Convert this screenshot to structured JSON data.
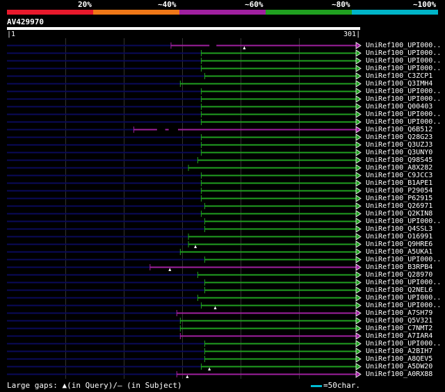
{
  "legend": {
    "labels": [
      "20%",
      "~40%",
      "~60%",
      "~80%",
      "~100%"
    ],
    "colors": [
      "#e8192c",
      "#f07818",
      "#a020a0",
      "#20a020",
      "#00b4c8"
    ]
  },
  "query": {
    "id": "AV429970",
    "start": "1",
    "end": "301",
    "length": 301
  },
  "footer": {
    "gaps_text": "Large gaps: ▲(in Query)/– (in Subject)",
    "scale_text": "=50char."
  },
  "colors": {
    "unaligned": "#0a0a5a",
    "magenta": "#a020a0",
    "green": "#20a020"
  },
  "hits": [
    {
      "label": "UniRef100_UPI000..",
      "start": 142,
      "color": "magenta",
      "marker": 205,
      "gaps": [
        [
          175,
          181
        ]
      ]
    },
    {
      "label": "UniRef100_UPI000..",
      "start": 168,
      "color": "green"
    },
    {
      "label": "UniRef100_UPI000..",
      "start": 168,
      "color": "green"
    },
    {
      "label": "UniRef100_UPI000..",
      "start": 168,
      "color": "green"
    },
    {
      "label": "UniRef100_C3ZCP1",
      "start": 171,
      "color": "green"
    },
    {
      "label": "UniRef100_Q3IMH4",
      "start": 150,
      "color": "green"
    },
    {
      "label": "UniRef100_UPI000..",
      "start": 168,
      "color": "green"
    },
    {
      "label": "UniRef100_UPI000..",
      "start": 168,
      "color": "green"
    },
    {
      "label": "UniRef100_Q00403",
      "start": 168,
      "color": "green"
    },
    {
      "label": "UniRef100_UPI000..",
      "start": 168,
      "color": "green"
    },
    {
      "label": "UniRef100_UPI000..",
      "start": 168,
      "color": "green"
    },
    {
      "label": "UniRef100_Q6B512",
      "start": 110,
      "color": "magenta",
      "gaps": [
        [
          130,
          137
        ],
        [
          140,
          148
        ]
      ]
    },
    {
      "label": "UniRef100_Q28G23",
      "start": 168,
      "color": "green"
    },
    {
      "label": "UniRef100_Q3UZJ3",
      "start": 168,
      "color": "green"
    },
    {
      "label": "UniRef100_Q3UNY0",
      "start": 168,
      "color": "green"
    },
    {
      "label": "UniRef100_Q98S45",
      "start": 165,
      "color": "green"
    },
    {
      "label": "UniRef100_A8X282",
      "start": 157,
      "color": "green"
    },
    {
      "label": "UniRef100_C9JCC3",
      "start": 168,
      "color": "green"
    },
    {
      "label": "UniRef100_B1APE1",
      "start": 168,
      "color": "green"
    },
    {
      "label": "UniRef100_P29054",
      "start": 168,
      "color": "green"
    },
    {
      "label": "UniRef100_P62915",
      "start": 168,
      "color": "green"
    },
    {
      "label": "UniRef100_Q26971",
      "start": 171,
      "color": "green"
    },
    {
      "label": "UniRef100_Q2KIN8",
      "start": 168,
      "color": "green"
    },
    {
      "label": "UniRef100_UPI000..",
      "start": 171,
      "color": "green"
    },
    {
      "label": "UniRef100_Q4SSL3",
      "start": 171,
      "color": "green"
    },
    {
      "label": "UniRef100_O16991",
      "start": 157,
      "color": "green"
    },
    {
      "label": "UniRef100_Q9HRE6",
      "start": 157,
      "color": "green",
      "marker": 163
    },
    {
      "label": "UniRef100_A5UKA1",
      "start": 150,
      "color": "green"
    },
    {
      "label": "UniRef100_UPI000..",
      "start": 171,
      "color": "green"
    },
    {
      "label": "UniRef100_B3RPB4",
      "start": 124,
      "color": "magenta",
      "marker": 141
    },
    {
      "label": "UniRef100_Q28970",
      "start": 165,
      "color": "green"
    },
    {
      "label": "UniRef100_UPI000..",
      "start": 171,
      "color": "green"
    },
    {
      "label": "UniRef100_Q2NEL6",
      "start": 171,
      "color": "green"
    },
    {
      "label": "UniRef100_UPI000..",
      "start": 165,
      "color": "green"
    },
    {
      "label": "UniRef100_UPI000..",
      "start": 168,
      "color": "green",
      "marker": 180
    },
    {
      "label": "UniRef100_A7SH79",
      "start": 147,
      "color": "magenta"
    },
    {
      "label": "UniRef100_Q5V321",
      "start": 150,
      "color": "green"
    },
    {
      "label": "UniRef100_C7NMT2",
      "start": 150,
      "color": "green"
    },
    {
      "label": "UniRef100_A7IAR4",
      "start": 150,
      "color": "magenta"
    },
    {
      "label": "UniRef100_UPI000..",
      "start": 171,
      "color": "green"
    },
    {
      "label": "UniRef100_A2BIH7",
      "start": 171,
      "color": "green"
    },
    {
      "label": "UniRef100_A8QEV5",
      "start": 171,
      "color": "green"
    },
    {
      "label": "UniRef100_A5DW20",
      "start": 168,
      "color": "green",
      "marker": 175
    },
    {
      "label": "UniRef100_A0RX88",
      "start": 147,
      "color": "magenta",
      "marker": 156
    }
  ]
}
